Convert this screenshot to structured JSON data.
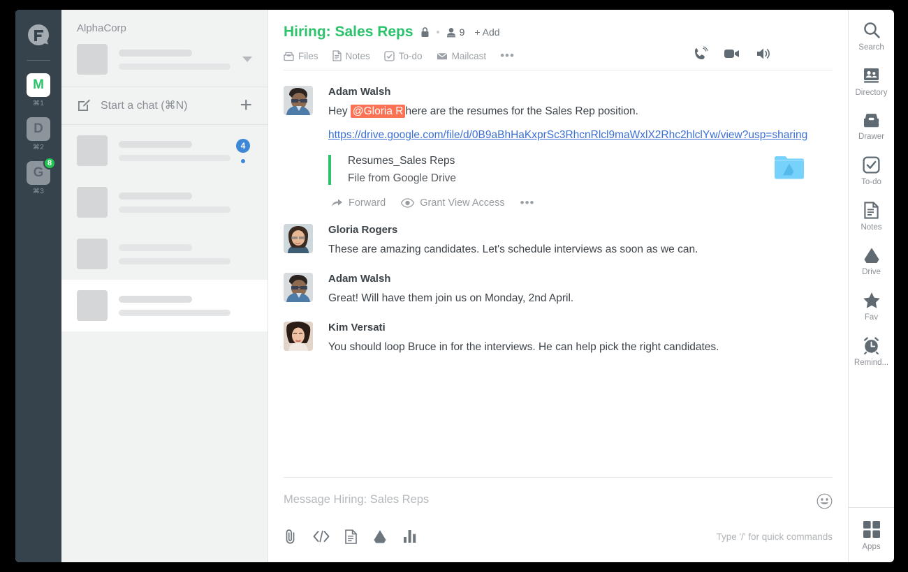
{
  "left_rail": {
    "logo_icon": "fleep-bubble-logo",
    "apps": [
      {
        "letter": "M",
        "shortcut": "⌘1",
        "active": true,
        "badge": null
      },
      {
        "letter": "D",
        "shortcut": "⌘2",
        "active": false,
        "badge": null
      },
      {
        "letter": "G",
        "shortcut": "⌘3",
        "active": false,
        "badge": "8"
      }
    ]
  },
  "chat_list": {
    "org_name": "AlphaCorp",
    "start_chat_label": "Start a chat (⌘N)",
    "new_chat_icon": "compose-icon",
    "add_icon": "plus-icon",
    "rows": [
      {
        "selected": false,
        "badge": "4",
        "dot": true
      },
      {
        "selected": false,
        "badge": null,
        "dot": false
      },
      {
        "selected": false,
        "badge": null,
        "dot": false
      },
      {
        "selected": true,
        "badge": null,
        "dot": false
      }
    ]
  },
  "chat_header": {
    "title": "Hiring: Sales Reps",
    "lock_icon": "lock-icon",
    "member_icon": "person-icon",
    "member_count": "9",
    "add_label": "+ Add",
    "tabs": [
      {
        "label": "Files",
        "icon": "files-icon"
      },
      {
        "label": "Notes",
        "icon": "notes-icon"
      },
      {
        "label": "To-do",
        "icon": "todo-icon"
      },
      {
        "label": "Mailcast",
        "icon": "mail-icon"
      }
    ],
    "more_label": "•••",
    "actions": [
      {
        "icon": "phone-call-icon"
      },
      {
        "icon": "video-camera-icon"
      },
      {
        "icon": "speaker-icon"
      }
    ]
  },
  "messages": [
    {
      "author": "Adam Walsh",
      "avatar": "avatar-adam-walsh",
      "text_before": "Hey ",
      "mention": "@Gloria R",
      "text_after": "here are the resumes for the Sales Rep position.",
      "link": "https://drive.google.com/file/d/0B9aBhHaKxprSc3RhcnRlcl9maWxlX2Rhc2hlclYw/view?usp=sharing",
      "attachment": {
        "name": "Resumes_Sales Reps",
        "subtitle": "File from Google Drive",
        "icon": "google-drive-folder-icon",
        "actions": [
          {
            "label": "Forward",
            "icon": "forward-arrow-icon"
          },
          {
            "label": "Grant View Access",
            "icon": "eye-icon"
          }
        ],
        "more_label": "•••"
      }
    },
    {
      "author": "Gloria Rogers",
      "avatar": "avatar-gloria-rogers",
      "text": "These are amazing candidates. Let's schedule interviews as soon as we can."
    },
    {
      "author": "Adam Walsh",
      "avatar": "avatar-adam-walsh",
      "text": "Great! Will have them join us on Monday, 2nd April."
    },
    {
      "author": "Kim Versati",
      "avatar": "avatar-kim-versati",
      "text": "You should loop Bruce in for the interviews. He can help pick the right candidates."
    }
  ],
  "composer": {
    "placeholder": "Message Hiring: Sales Reps",
    "value": "",
    "emoji_icon": "smiley-icon",
    "hint": "Type '/' for quick commands",
    "icons": [
      {
        "name": "paperclip-icon"
      },
      {
        "name": "code-icon"
      },
      {
        "name": "document-icon"
      },
      {
        "name": "google-drive-icon"
      },
      {
        "name": "chart-icon"
      }
    ]
  },
  "right_rail": {
    "items": [
      {
        "label": "Search",
        "icon": "search-icon"
      },
      {
        "label": "Directory",
        "icon": "directory-icon"
      },
      {
        "label": "Drawer",
        "icon": "drawer-icon"
      },
      {
        "label": "To-do",
        "icon": "todo-check-icon"
      },
      {
        "label": "Notes",
        "icon": "notes-page-icon"
      },
      {
        "label": "Drive",
        "icon": "google-drive-icon"
      },
      {
        "label": "Fav",
        "icon": "star-icon"
      },
      {
        "label": "Remind...",
        "icon": "alarm-clock-icon"
      }
    ],
    "bottom": {
      "label": "Apps",
      "icon": "grid-apps-icon"
    }
  },
  "colors": {
    "accent_green": "#2dc26b",
    "mention_bg": "#fc7254",
    "link_blue": "#3b6fd4",
    "badge_blue": "#3d87d6",
    "rail_bg": "#36424c"
  }
}
